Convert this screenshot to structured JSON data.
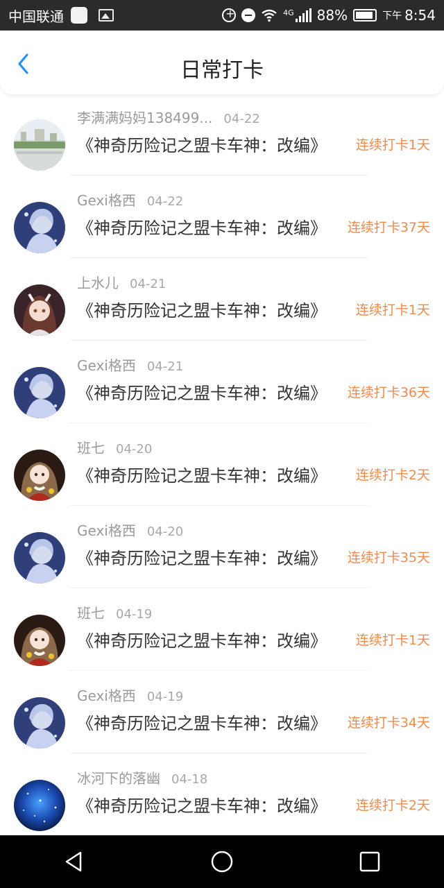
{
  "status_bar": {
    "carrier": "中国联通",
    "network": "4G",
    "battery": "88%",
    "time_prefix": "下午",
    "time": "8:54"
  },
  "header": {
    "title": "日常打卡",
    "back_icon": "chevron-left-icon"
  },
  "colors": {
    "accent_blue": "#1e90ff",
    "streak_orange": "#f08a4a"
  },
  "entries": [
    {
      "name": "李满满妈妈138499...",
      "date": "04-22",
      "title": "《神奇历险记之盟卡车神：改编》",
      "streak": "连续打卡1天",
      "avatar": "landscape"
    },
    {
      "name": "Gexi格西",
      "date": "04-22",
      "title": "《神奇历险记之盟卡车神：改编》",
      "streak": "连续打卡37天",
      "avatar": "anime-blue"
    },
    {
      "name": "上水儿",
      "date": "04-21",
      "title": "《神奇历险记之盟卡车神：改编》",
      "streak": "连续打卡1天",
      "avatar": "anime-girl"
    },
    {
      "name": "Gexi格西",
      "date": "04-21",
      "title": "《神奇历险记之盟卡车神：改编》",
      "streak": "连续打卡36天",
      "avatar": "anime-blue"
    },
    {
      "name": "班七",
      "date": "04-20",
      "title": "《神奇历险记之盟卡车神：改编》",
      "streak": "连续打卡2天",
      "avatar": "anime-red"
    },
    {
      "name": "Gexi格西",
      "date": "04-20",
      "title": "《神奇历险记之盟卡车神：改编》",
      "streak": "连续打卡35天",
      "avatar": "anime-blue"
    },
    {
      "name": "班七",
      "date": "04-19",
      "title": "《神奇历险记之盟卡车神：改编》",
      "streak": "连续打卡1天",
      "avatar": "anime-red"
    },
    {
      "name": "Gexi格西",
      "date": "04-19",
      "title": "《神奇历险记之盟卡车神：改编》",
      "streak": "连续打卡34天",
      "avatar": "anime-blue"
    },
    {
      "name": "冰河下的落幽",
      "date": "04-18",
      "title": "《神奇历险记之盟卡车神：改编》",
      "streak": "连续打卡2天",
      "avatar": "galaxy"
    }
  ],
  "nav_bar": {
    "back_icon": "triangle-back-icon",
    "home_icon": "circle-home-icon",
    "recents_icon": "square-recents-icon"
  }
}
